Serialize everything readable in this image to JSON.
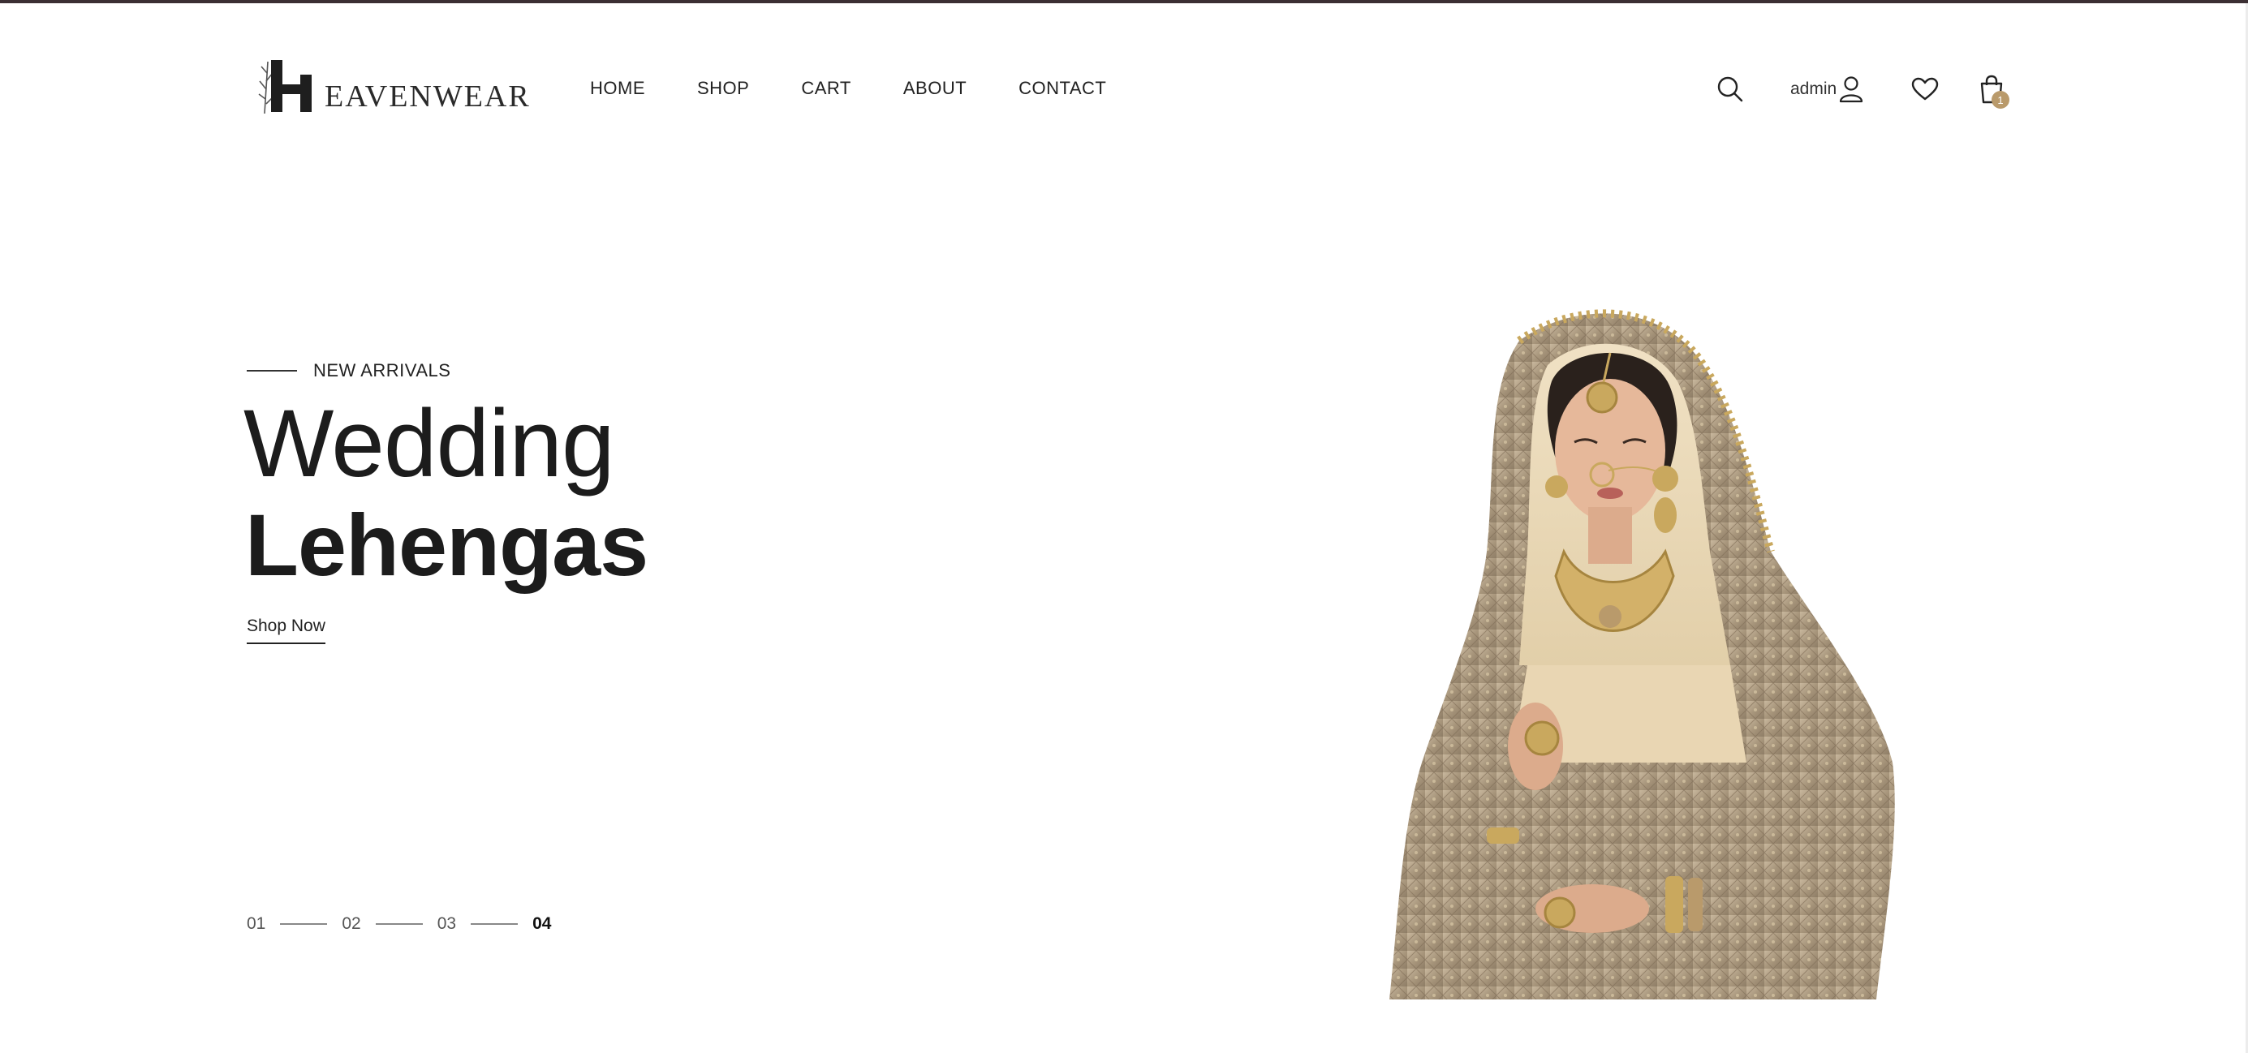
{
  "brand": {
    "logo_letter": "H",
    "logo_text": "EAVENWEAR"
  },
  "nav": {
    "items": [
      {
        "label": "HOME"
      },
      {
        "label": "SHOP"
      },
      {
        "label": "CART"
      },
      {
        "label": "ABOUT"
      },
      {
        "label": "CONTACT"
      }
    ]
  },
  "header": {
    "account_label": "admin",
    "cart_count": "1",
    "icons": [
      "search-icon",
      "user-icon",
      "heart-icon",
      "shopping-bag-icon"
    ]
  },
  "hero": {
    "eyebrow": "NEW ARRIVALS",
    "title_line1": "Wedding",
    "title_line2": "Lehengas",
    "cta_label": "Shop Now",
    "slides": [
      "01",
      "02",
      "03",
      "04"
    ],
    "active_slide": "04"
  },
  "colors": {
    "top_bar": "#3b2f33",
    "badge": "#b99a6b",
    "text": "#1c1c1c"
  }
}
